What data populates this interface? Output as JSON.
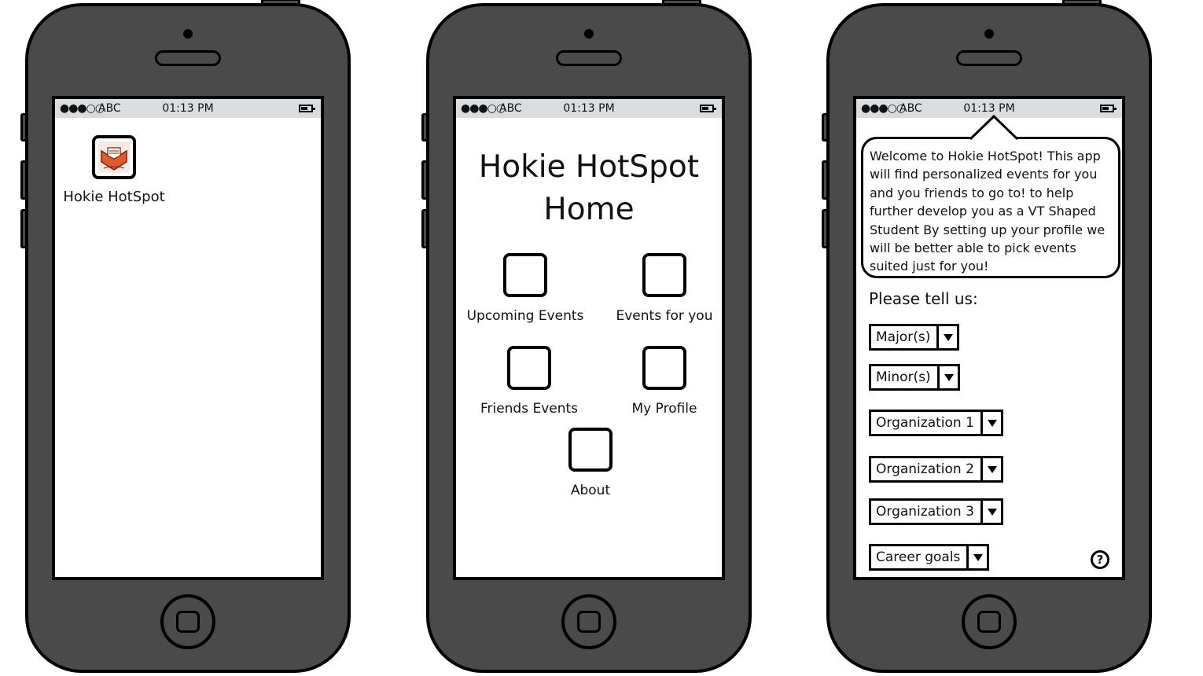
{
  "status_bar": {
    "signal": "●●●○○",
    "carrier": "ABC",
    "time": "01:13 PM"
  },
  "screen1": {
    "app_label": "Hokie HotSpot",
    "app_icon": "hokie-hotspot-logo-icon"
  },
  "screen2": {
    "title_line1": "Hokie HotSpot",
    "title_line2": "Home",
    "tiles": [
      {
        "label": "Upcoming Events"
      },
      {
        "label": "Events for you"
      },
      {
        "label": "Friends Events"
      },
      {
        "label": "My Profile"
      },
      {
        "label": "About"
      }
    ]
  },
  "screen3": {
    "welcome_text": "Welcome to Hokie HotSpot! This app will find personalized events for you and you friends to go to! to help further develop you as a VT Shaped Student By setting up your profile we will be better able to pick events suited just for you!",
    "prompt": "Please tell us:",
    "dropdowns": [
      {
        "label": "Major(s)"
      },
      {
        "label": "Minor(s)"
      },
      {
        "label": "Organization 1"
      },
      {
        "label": "Organization 2"
      },
      {
        "label": "Organization 3"
      },
      {
        "label": "Career goals"
      }
    ],
    "help_label": "?"
  },
  "colors": {
    "phone_body": "#4a4a4a",
    "status_bar": "#d9dde0",
    "icon_accent": "#e05a2b"
  }
}
